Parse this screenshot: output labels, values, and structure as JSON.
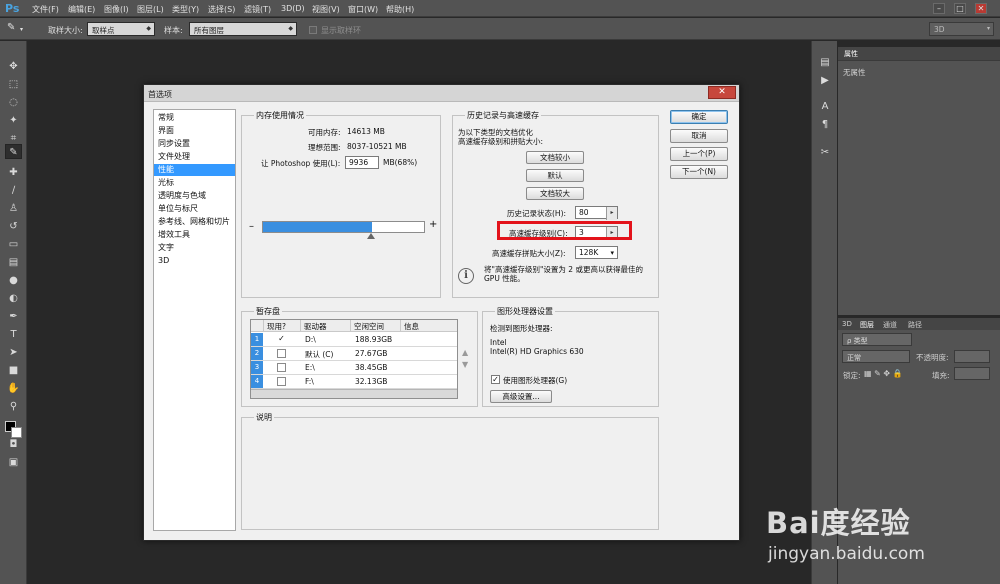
{
  "app": {
    "logo": "Ps"
  },
  "menu": [
    "文件(F)",
    "编辑(E)",
    "图像(I)",
    "图层(L)",
    "类型(Y)",
    "选择(S)",
    "滤镜(T)",
    "3D(D)",
    "视图(V)",
    "窗口(W)",
    "帮助(H)"
  ],
  "window_controls": {
    "minimize": "–",
    "restore": "□",
    "close": "✕"
  },
  "options_bar": {
    "sample_size_label": "取样大小:",
    "sample_size_value": "取样点",
    "sample_label": "样本:",
    "sample_value": "所有图层",
    "show_ring_label": "显示取样环",
    "workspace_value": "3D"
  },
  "properties_panel": {
    "tab": "属性",
    "content": "无属性"
  },
  "layers_panel": {
    "tabs": [
      "3D",
      "图层",
      "通道",
      "路径"
    ],
    "active_tab": "图层",
    "filter_value": "ρ 类型",
    "blend_mode": "正常",
    "opacity_label": "不透明度:",
    "lock_label": "锁定:",
    "fill_label": "填充:"
  },
  "dialog": {
    "title": "首选项",
    "categories": [
      "常规",
      "界面",
      "同步设置",
      "文件处理",
      "性能",
      "光标",
      "透明度与色域",
      "单位与标尺",
      "参考线、网格和切片",
      "增效工具",
      "文字",
      "3D"
    ],
    "selected_category": "性能",
    "buttons": {
      "ok": "确定",
      "cancel": "取消",
      "prev": "上一个(P)",
      "next": "下一个(N)"
    },
    "memory": {
      "title": "内存使用情况",
      "available_label": "可用内存:",
      "available_value": "14613 MB",
      "ideal_label": "理想范围:",
      "ideal_value": "8037-10521 MB",
      "let_label": "让 Photoshop 使用(L):",
      "let_value": "9936",
      "let_unit": "MB(68%)",
      "slider_fraction": 0.68,
      "minus": "–",
      "plus": "+"
    },
    "history": {
      "title": "历史记录与高速缓存",
      "desc_line1": "为以下类型的文档优化",
      "desc_line2": "高速缓存级别和拼贴大小:",
      "btn_tall_thin": "文档较小",
      "btn_default": "默认",
      "btn_big_flat": "文档较大",
      "history_states_label": "历史记录状态(H):",
      "history_states_value": "80",
      "cache_levels_label": "高速缓存级别(C):",
      "cache_levels_value": "3",
      "tile_size_label": "高速缓存拼贴大小(Z):",
      "tile_size_value": "128K",
      "info_line1": "将\"高速缓存级别\"设置为 2 或更高以获得最佳的",
      "info_line2": "GPU 性能。"
    },
    "scratch": {
      "title": "暂存盘",
      "headers": [
        "现用?",
        "驱动器",
        "空闲空间",
        "信息"
      ],
      "rows": [
        {
          "num": "1",
          "checked": "✓",
          "drive": "D:\\",
          "free": "188.93GB",
          "info": ""
        },
        {
          "num": "2",
          "checked": "",
          "drive": "默认 (C)",
          "free": "27.67GB",
          "info": ""
        },
        {
          "num": "3",
          "checked": "",
          "drive": "E:\\",
          "free": "38.45GB",
          "info": ""
        },
        {
          "num": "4",
          "checked": "",
          "drive": "F:\\",
          "free": "32.13GB",
          "info": ""
        }
      ],
      "up": "▲",
      "down": "▼"
    },
    "gpu": {
      "title": "图形处理器设置",
      "detected_label": "检测到图形处理器:",
      "vendor": "Intel",
      "model": "Intel(R) HD Graphics 630",
      "use_gpu_label": "使用图形处理器(G)",
      "use_gpu_checked": "✓",
      "advanced_button": "高级设置..."
    },
    "description": {
      "title": "说明"
    }
  },
  "watermark": {
    "brand": "Bai度经验",
    "url": "jingyan.baidu.com"
  }
}
